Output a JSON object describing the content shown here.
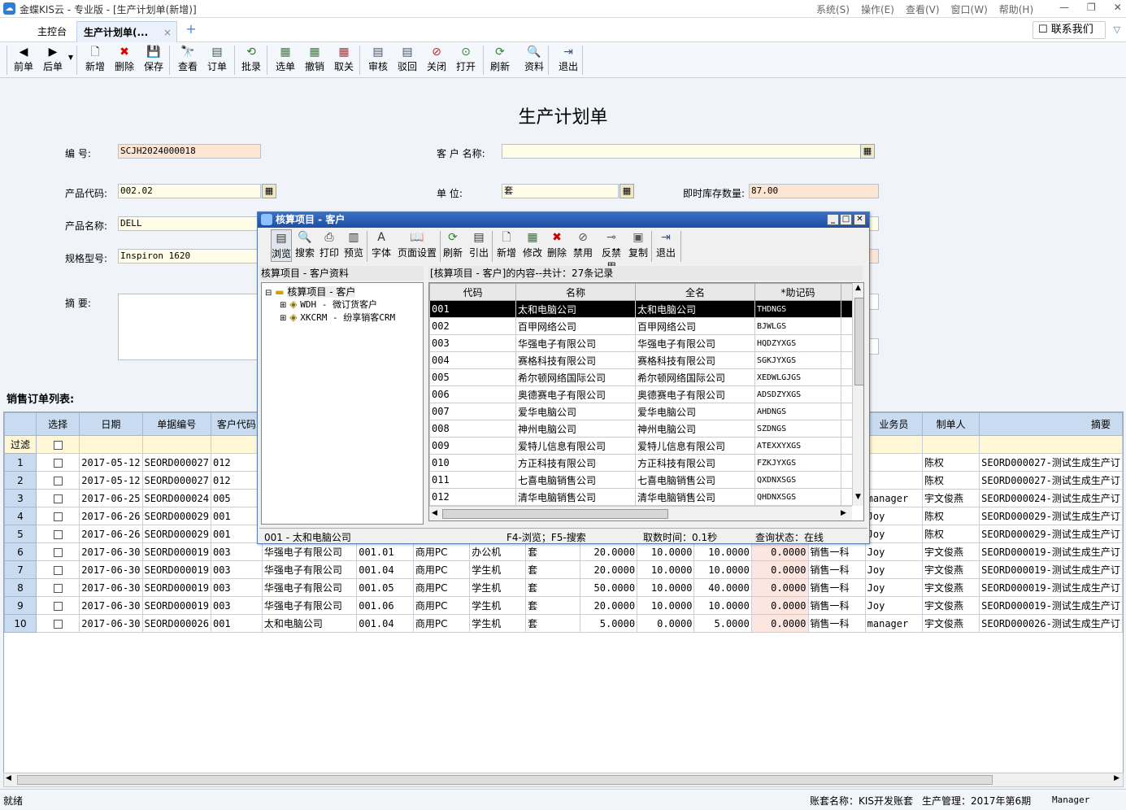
{
  "app": {
    "title": "金蝶KIS云 - 专业版 - [生产计划单(新增)]",
    "menu": [
      "系统(S)",
      "操作(E)",
      "查看(V)",
      "窗口(W)",
      "帮助(H)"
    ]
  },
  "tabs": {
    "home": "主控台",
    "plan": "生产计划单(...",
    "close": "×",
    "add": "+"
  },
  "contact": "联系我们",
  "toolbar": [
    {
      "label": "前单",
      "icon": "◀"
    },
    {
      "label": "后单",
      "icon": "▶"
    },
    {
      "label": "新增",
      "icon": "🗋"
    },
    {
      "label": "删除",
      "icon": "✖"
    },
    {
      "label": "保存",
      "icon": "💾"
    },
    {
      "label": "查看",
      "icon": "🔭"
    },
    {
      "label": "订单",
      "icon": "▤"
    },
    {
      "label": "批录",
      "icon": "⟲"
    },
    {
      "label": "选单",
      "icon": "▦"
    },
    {
      "label": "撤销",
      "icon": "▦"
    },
    {
      "label": "取关",
      "icon": "▦"
    },
    {
      "label": "审核",
      "icon": "▤"
    },
    {
      "label": "驳回",
      "icon": "▤"
    },
    {
      "label": "关闭",
      "icon": "⊘"
    },
    {
      "label": "打开",
      "icon": "⊙"
    },
    {
      "label": "刷新",
      "icon": "⟳"
    },
    {
      "label": "资料",
      "icon": "🔍"
    },
    {
      "label": "退出",
      "icon": "⇥"
    }
  ],
  "form": {
    "title": "生产计划单",
    "number_label": "编    号:",
    "number": "SCJH2024000018",
    "customer_label": "客 户 名称:",
    "customer": "",
    "product_code_label": "产品代码:",
    "product_code": "002.02",
    "unit_label": "单      位:",
    "unit": "套",
    "stock_label": "即时库存数量:",
    "stock": "87.00",
    "product_name_label": "产品名称:",
    "product_name": "DELL",
    "spec_label": "规格型号:",
    "spec": "Inspiron 1620",
    "memo_label": "摘      要:",
    "memo": ""
  },
  "orders": {
    "title": "销售订单列表:",
    "headers": [
      "选择",
      "日期",
      "单据编号",
      "客户代码",
      "业务员",
      "制单人",
      "摘要"
    ],
    "filter_label": "过滤",
    "rows": [
      {
        "n": "1",
        "date": "2017-05-12",
        "bill": "SEORD000027",
        "cust": "012",
        "cname": "",
        "code": "",
        "cat": "",
        "type": "",
        "unit": "",
        "q1": "",
        "q2": "",
        "q3": "",
        "q4": "",
        "dept": "",
        "sales": "",
        "maker": "陈权",
        "memo": "SEORD000027-测试生成生产订"
      },
      {
        "n": "2",
        "date": "2017-05-12",
        "bill": "SEORD000027",
        "cust": "012",
        "cname": "",
        "code": "",
        "cat": "",
        "type": "",
        "unit": "",
        "q1": "",
        "q2": "",
        "q3": "",
        "q4": "",
        "dept": "",
        "sales": "",
        "maker": "陈权",
        "memo": "SEORD000027-测试生成生产订"
      },
      {
        "n": "3",
        "date": "2017-06-25",
        "bill": "SEORD000024",
        "cust": "005",
        "cname": "",
        "code": "",
        "cat": "",
        "type": "",
        "unit": "",
        "q1": "",
        "q2": "",
        "q3": "",
        "q4": "",
        "dept": "",
        "sales": "manager",
        "maker": "宇文俊燕",
        "memo": "SEORD000024-测试生成生产订"
      },
      {
        "n": "4",
        "date": "2017-06-26",
        "bill": "SEORD000029",
        "cust": "001",
        "cname": "",
        "code": "",
        "cat": "",
        "type": "",
        "unit": "",
        "q1": "",
        "q2": "",
        "q3": "",
        "q4": "",
        "dept": "",
        "sales": "Joy",
        "maker": "陈权",
        "memo": "SEORD000029-测试生成生产订"
      },
      {
        "n": "5",
        "date": "2017-06-26",
        "bill": "SEORD000029",
        "cust": "001",
        "cname": "",
        "code": "",
        "cat": "",
        "type": "",
        "unit": "",
        "q1": "",
        "q2": "",
        "q3": "",
        "q4": "",
        "dept": "",
        "sales": "Joy",
        "maker": "陈权",
        "memo": "SEORD000029-测试生成生产订"
      },
      {
        "n": "6",
        "date": "2017-06-30",
        "bill": "SEORD000019",
        "cust": "003",
        "cname": "华强电子有限公司",
        "code": "001.01",
        "cat": "商用PC",
        "type": "办公机",
        "unit": "套",
        "q1": "20.0000",
        "q2": "10.0000",
        "q3": "10.0000",
        "q4": "0.0000",
        "dept": "销售一科",
        "sales": "Joy",
        "maker": "宇文俊燕",
        "memo": "SEORD000019-测试生成生产订"
      },
      {
        "n": "7",
        "date": "2017-06-30",
        "bill": "SEORD000019",
        "cust": "003",
        "cname": "华强电子有限公司",
        "code": "001.04",
        "cat": "商用PC",
        "type": "学生机",
        "unit": "套",
        "q1": "20.0000",
        "q2": "10.0000",
        "q3": "10.0000",
        "q4": "0.0000",
        "dept": "销售一科",
        "sales": "Joy",
        "maker": "宇文俊燕",
        "memo": "SEORD000019-测试生成生产订"
      },
      {
        "n": "8",
        "date": "2017-06-30",
        "bill": "SEORD000019",
        "cust": "003",
        "cname": "华强电子有限公司",
        "code": "001.05",
        "cat": "商用PC",
        "type": "学生机",
        "unit": "套",
        "q1": "50.0000",
        "q2": "10.0000",
        "q3": "40.0000",
        "q4": "0.0000",
        "dept": "销售一科",
        "sales": "Joy",
        "maker": "宇文俊燕",
        "memo": "SEORD000019-测试生成生产订"
      },
      {
        "n": "9",
        "date": "2017-06-30",
        "bill": "SEORD000019",
        "cust": "003",
        "cname": "华强电子有限公司",
        "code": "001.06",
        "cat": "商用PC",
        "type": "学生机",
        "unit": "套",
        "q1": "20.0000",
        "q2": "10.0000",
        "q3": "10.0000",
        "q4": "0.0000",
        "dept": "销售一科",
        "sales": "Joy",
        "maker": "宇文俊燕",
        "memo": "SEORD000019-测试生成生产订"
      },
      {
        "n": "10",
        "date": "2017-06-30",
        "bill": "SEORD000026",
        "cust": "001",
        "cname": "太和电脑公司",
        "code": "001.04",
        "cat": "商用PC",
        "type": "学生机",
        "unit": "套",
        "q1": "5.0000",
        "q2": "0.0000",
        "q3": "5.0000",
        "q4": "0.0000",
        "dept": "销售一科",
        "sales": "manager",
        "maker": "宇文俊燕",
        "memo": "SEORD000026-测试生成生产订"
      }
    ]
  },
  "status": {
    "left": "就绪",
    "account": "账套名称：KIS开发账套",
    "period": "生产管理：2017年第6期",
    "user": "Manager"
  },
  "dialog": {
    "title": "核算项目 - 客户",
    "tools": [
      "浏览",
      "搜索",
      "打印",
      "预览",
      "字体",
      "页面设置",
      "刷新",
      "引出",
      "新增",
      "修改",
      "删除",
      "禁用",
      "反禁用",
      "复制",
      "退出"
    ],
    "tree_header": "核算项目 - 客户资料",
    "tree": [
      "核算项目 - 客户",
      "WDH - 微订货客户",
      "XKCRM - 纷享销客CRM"
    ],
    "list_header": "[核算项目 - 客户]的内容--共计：27条记录",
    "columns": [
      "代码",
      "名称",
      "全名",
      "*助记码"
    ],
    "rows": [
      [
        "001",
        "太和电脑公司",
        "太和电脑公司",
        "THDNGS"
      ],
      [
        "002",
        "百甲网络公司",
        "百甲网络公司",
        "BJWLGS"
      ],
      [
        "003",
        "华强电子有限公司",
        "华强电子有限公司",
        "HQDZYXGS"
      ],
      [
        "004",
        "赛格科技有限公司",
        "赛格科技有限公司",
        "SGKJYXGS"
      ],
      [
        "005",
        "希尔顿网络国际公司",
        "希尔顿网络国际公司",
        "XEDWLGJGS"
      ],
      [
        "006",
        "奥德赛电子有限公司",
        "奥德赛电子有限公司",
        "ADSDZYXGS"
      ],
      [
        "007",
        "爱华电脑公司",
        "爱华电脑公司",
        "AHDNGS"
      ],
      [
        "008",
        "神州电脑公司",
        "神州电脑公司",
        "SZDNGS"
      ],
      [
        "009",
        "爱特儿信息有限公司",
        "爱特儿信息有限公司",
        "ATEXXYXGS"
      ],
      [
        "010",
        "方正科技有限公司",
        "方正科技有限公司",
        "FZKJYXGS"
      ],
      [
        "011",
        "七喜电脑销售公司",
        "七喜电脑销售公司",
        "QXDNXSGS"
      ],
      [
        "012",
        "清华电脑销售公司",
        "清华电脑销售公司",
        "QHDNXSGS"
      ]
    ],
    "status": {
      "current": "001 - 太和电脑公司",
      "keys": "F4-浏览；F5-搜索",
      "time": "取数时间：0.1秒",
      "state": "查询状态：在线"
    }
  }
}
